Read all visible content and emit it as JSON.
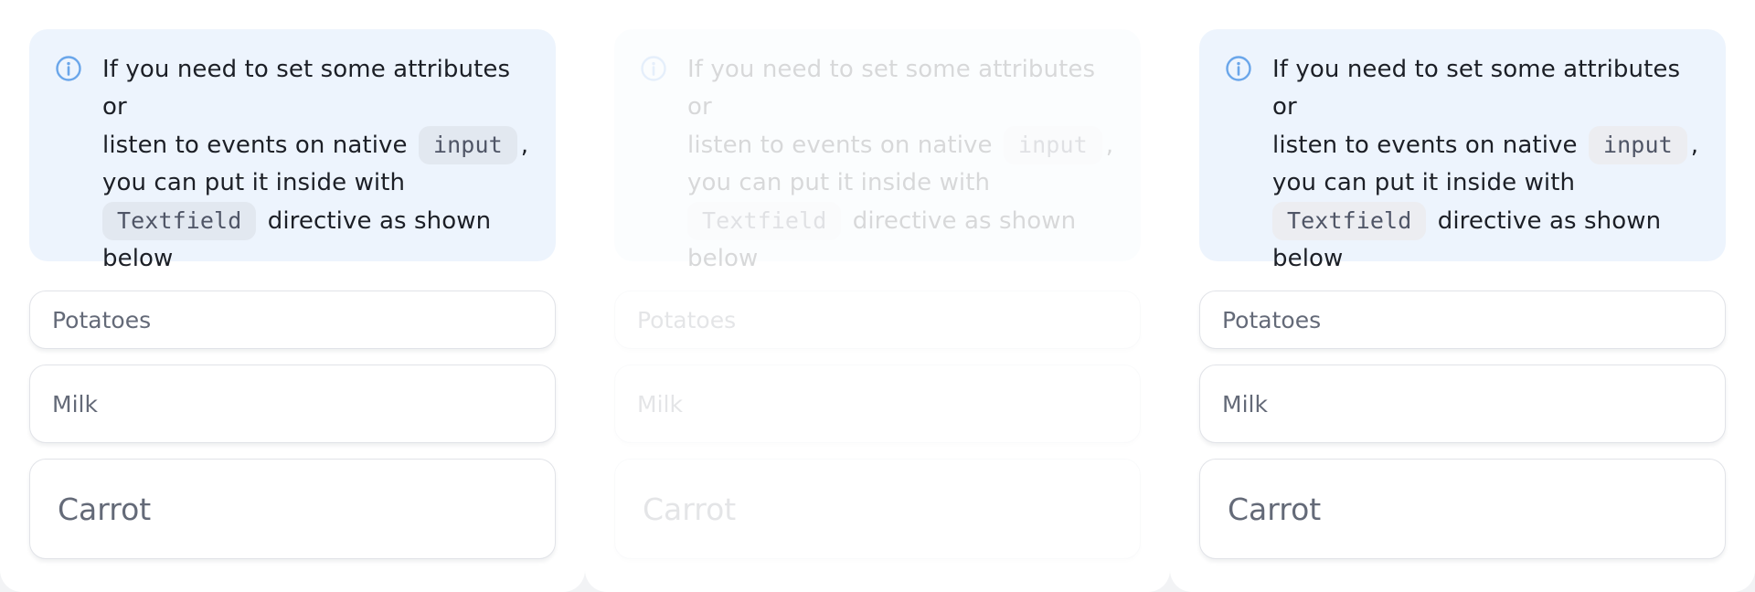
{
  "panels": [
    {
      "info": {
        "line1": "If you need to set some attributes or",
        "line2a": "listen to events on native ",
        "code1": "input",
        "line2b": ",",
        "line3": "you can put it inside with",
        "code2": "Textfield",
        "line4a": " directive as shown",
        "line5": "below"
      },
      "fields": [
        "Potatoes",
        "Milk",
        "Carrot"
      ]
    },
    {
      "info": {
        "line1": "If you need to set some attributes or",
        "line2a": "listen to events on native ",
        "code1": "input",
        "line2b": ",",
        "line3": "you can put it inside with",
        "code2": "Textfield",
        "line4a": " directive as shown",
        "line5": "below"
      },
      "fields": [
        "Potatoes",
        "Milk",
        "Carrot"
      ]
    },
    {
      "info": {
        "line1": "If you need to set some attributes or",
        "line2a": "listen to events on native ",
        "code1": "input",
        "line2b": ",",
        "line3": "you can put it inside with",
        "code2": "Textfield",
        "line4a": " directive as shown",
        "line5": "below"
      },
      "fields": [
        "Potatoes",
        "Milk",
        "Carrot"
      ]
    }
  ],
  "icons": {
    "info": "info-circle-icon"
  },
  "colors": {
    "info_background": "#edf4fd",
    "info_icon": "#6aa6ea",
    "code_background": "#e2e8f0",
    "field_border": "#e1e3e8",
    "field_text": "#646a78"
  }
}
